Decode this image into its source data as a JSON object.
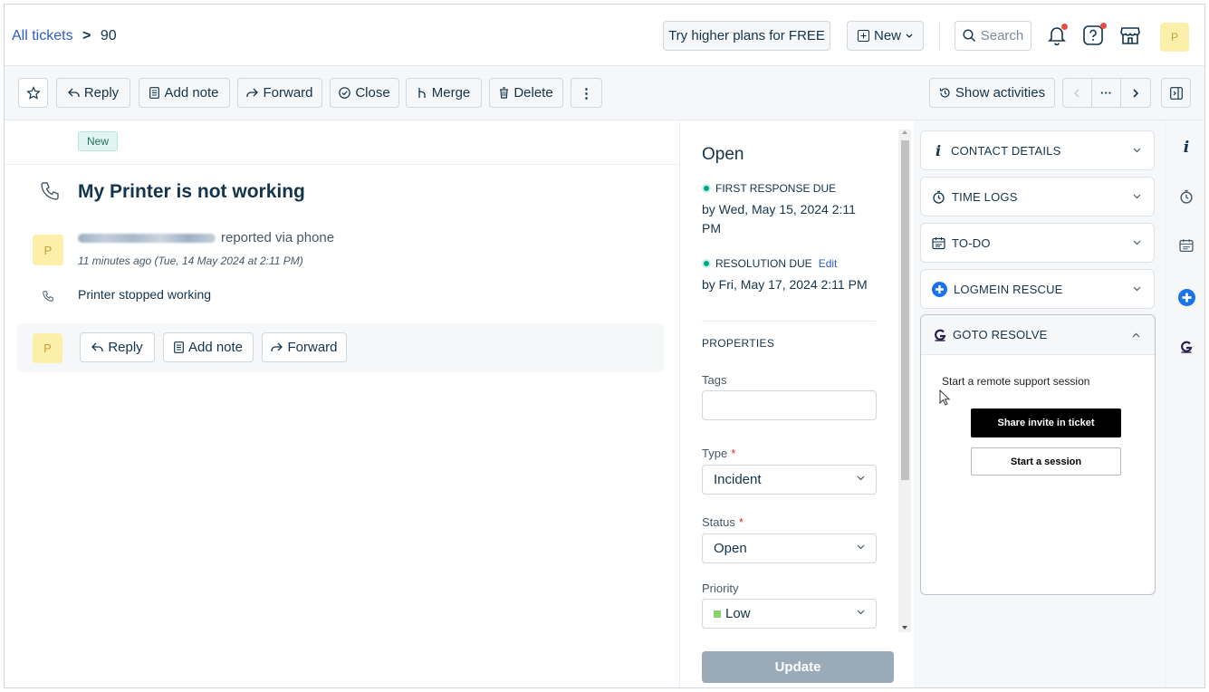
{
  "header": {
    "breadcrumb_link": "All tickets",
    "breadcrumb_sep": ">",
    "ticket_number": "90",
    "try_plans_label": "Try higher plans for FREE",
    "new_label": "New",
    "search_label": "Search",
    "avatar_initial": "P"
  },
  "toolbar": {
    "reply_label": "Reply",
    "add_note_label": "Add note",
    "forward_label": "Forward",
    "close_label": "Close",
    "merge_label": "Merge",
    "delete_label": "Delete",
    "more_label": "⋮",
    "show_activities_label": "Show activities",
    "pager_more_label": "···"
  },
  "ticket": {
    "status_tag": "New",
    "subject": "My Printer is not working",
    "requester_initial": "P",
    "reported_via": "reported via phone",
    "time": "11 minutes ago (Tue, 14 May 2024 at 2:11 PM)",
    "description": "Printer stopped working",
    "reply_avatar_initial": "P",
    "reply_label": "Reply",
    "add_note_label": "Add note",
    "forward_label": "Forward"
  },
  "properties": {
    "status_title": "Open",
    "first_response_label": "FIRST RESPONSE DUE",
    "first_response_value": "by Wed, May 15, 2024 2:11 PM",
    "resolution_label": "RESOLUTION DUE",
    "resolution_edit": "Edit",
    "resolution_value": "by Fri, May 17, 2024 2:11 PM",
    "heading": "PROPERTIES",
    "tags_label": "Tags",
    "tags_value": "",
    "type_label": "Type",
    "type_value": "Incident",
    "status_label": "Status",
    "status_value": "Open",
    "priority_label": "Priority",
    "priority_value": "Low",
    "required_mark": "*",
    "update_label": "Update"
  },
  "apps": {
    "contact_details": "CONTACT DETAILS",
    "time_logs": "TIME LOGS",
    "todo": "TO-DO",
    "logmein": "LOGMEIN RESCUE",
    "goto_resolve": "GOTO RESOLVE",
    "goto_desc": "Start a remote support session",
    "share_invite": "Share invite in ticket",
    "start_session": "Start a session"
  },
  "colors": {
    "link": "#2c5cc5",
    "sla_green": "#00a886",
    "low_priority": "#8bd16e",
    "notification_dot": "#e54d42",
    "update_disabled": "#9aaab9"
  }
}
